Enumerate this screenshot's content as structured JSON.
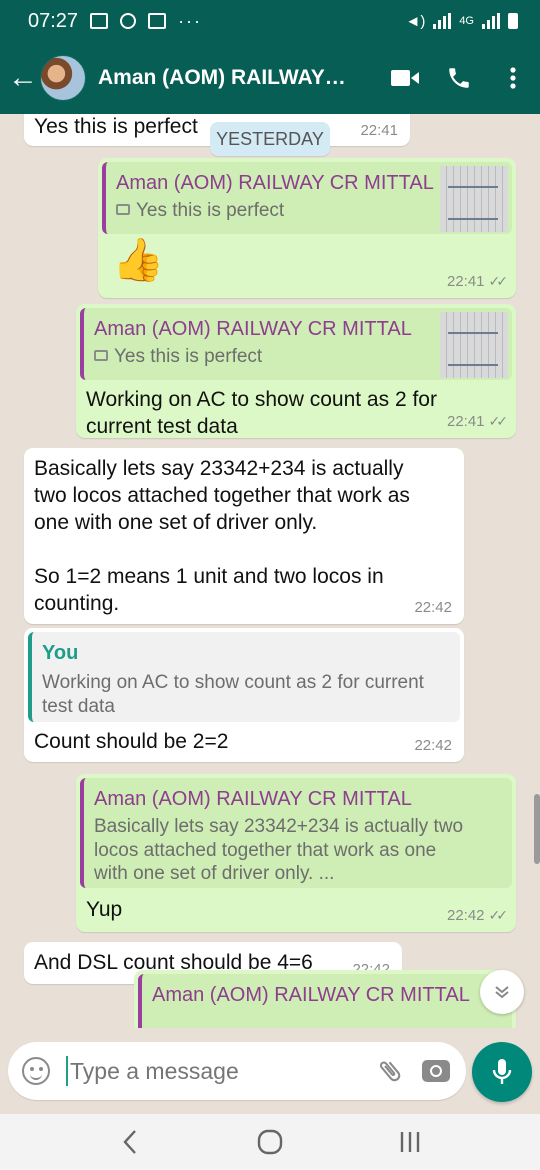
{
  "status_bar": {
    "time": "07:27",
    "dots": "···",
    "network": "4G"
  },
  "header": {
    "back_glyph": "←",
    "title": "Aman (AOM) RAILWAY…"
  },
  "date_chip": "YESTERDAY",
  "messages": [
    {
      "dir": "in",
      "text": "Yes this is perfect",
      "time": "22:41"
    },
    {
      "dir": "out",
      "quote_author": "Aman (AOM) RAILWAY CR MITTAL",
      "quote_text": "Yes this is perfect",
      "text": "👍",
      "time": "22:41"
    },
    {
      "dir": "out",
      "quote_author": "Aman (AOM) RAILWAY CR MITTAL",
      "quote_text": "Yes this is perfect",
      "text_lines": [
        "Working on AC to show count as 2 for",
        "current test data"
      ],
      "time": "22:41"
    },
    {
      "dir": "in",
      "text_lines": [
        "Basically lets say 23342+234 is actually",
        "two locos attached together that work as",
        "one with one set of driver only.",
        "",
        "So 1=2 means 1 unit and two locos in",
        "counting."
      ],
      "time": "22:42"
    },
    {
      "dir": "in",
      "quote_author": "You",
      "quote_lines": [
        "Working on AC to show count as 2 for current",
        "test data"
      ],
      "text": "Count should be 2=2",
      "time": "22:42"
    },
    {
      "dir": "out",
      "quote_author": "Aman (AOM) RAILWAY CR MITTAL",
      "quote_lines": [
        "Basically lets say 23342+234 is actually two",
        "locos attached together that work as one",
        "with one set of driver only. ..."
      ],
      "text": "Yup",
      "time": "22:42"
    },
    {
      "dir": "in",
      "text": "And DSL count should be 4=6",
      "time": "22:42"
    },
    {
      "dir": "out",
      "quote_author": "Aman (AOM) RAILWAY CR MITTAL"
    }
  ],
  "composer": {
    "placeholder": "Type a message"
  },
  "colors": {
    "header": "#075e54",
    "outgoing": "#dcf8c6",
    "incoming": "#ffffff",
    "accent": "#00897b",
    "quote_author": "#8e3d8f"
  },
  "icons": [
    "back-arrow-icon",
    "video-call-icon",
    "phone-icon",
    "more-vert-icon",
    "emoji-icon",
    "attach-icon",
    "camera-icon",
    "mic-icon",
    "scroll-down-icon",
    "nav-back-icon",
    "nav-home-icon",
    "nav-recents-icon"
  ]
}
